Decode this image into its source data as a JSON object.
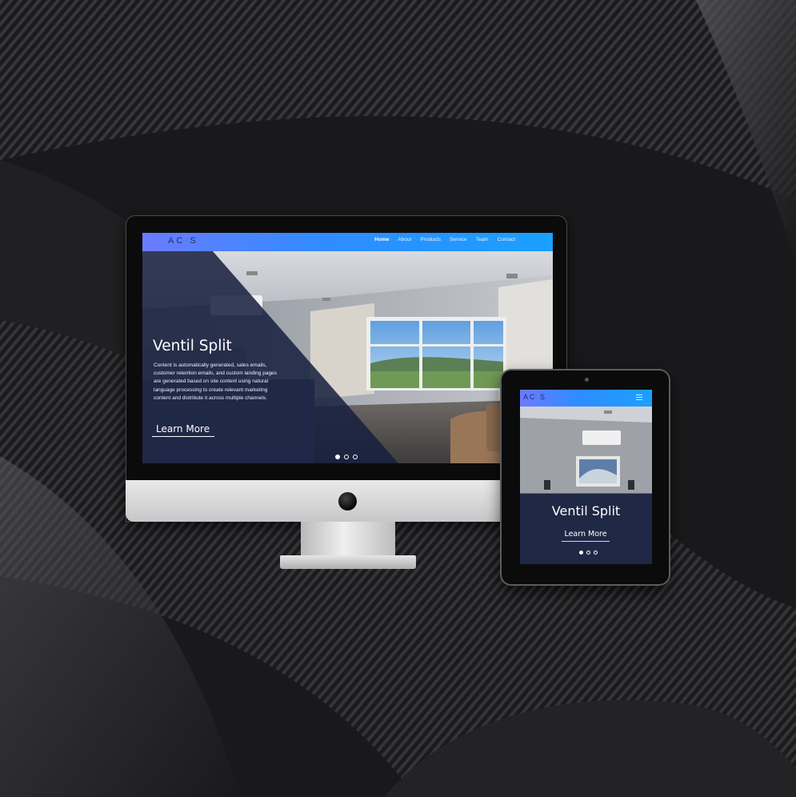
{
  "desktop": {
    "brand": "AC  S",
    "nav": [
      "Home",
      "About",
      "Products",
      "Service",
      "Team",
      "Contact"
    ],
    "active_nav": "Home",
    "hero": {
      "title": "Ventil Split",
      "text": "Content is automatically generated, sales emails, customer retention emails, and custom landing pages are generated based on site content using natural language processing to create relevant marketing content and distribute it across multiple channels.",
      "button": "Learn More"
    },
    "slides": 3,
    "active_slide": 1
  },
  "tablet": {
    "brand": "AC  S",
    "hero": {
      "title": "Ventil Split",
      "button": "Learn More"
    },
    "slides": 3,
    "active_slide": 1
  },
  "colors": {
    "nav_gradient_start": "#6b7bff",
    "nav_gradient_end": "#1aa0ff",
    "overlay": "#16203e",
    "background": "#1c1c1e"
  },
  "icons": [
    "menu-icon",
    "apple-logo-icon",
    "camera-icon"
  ]
}
